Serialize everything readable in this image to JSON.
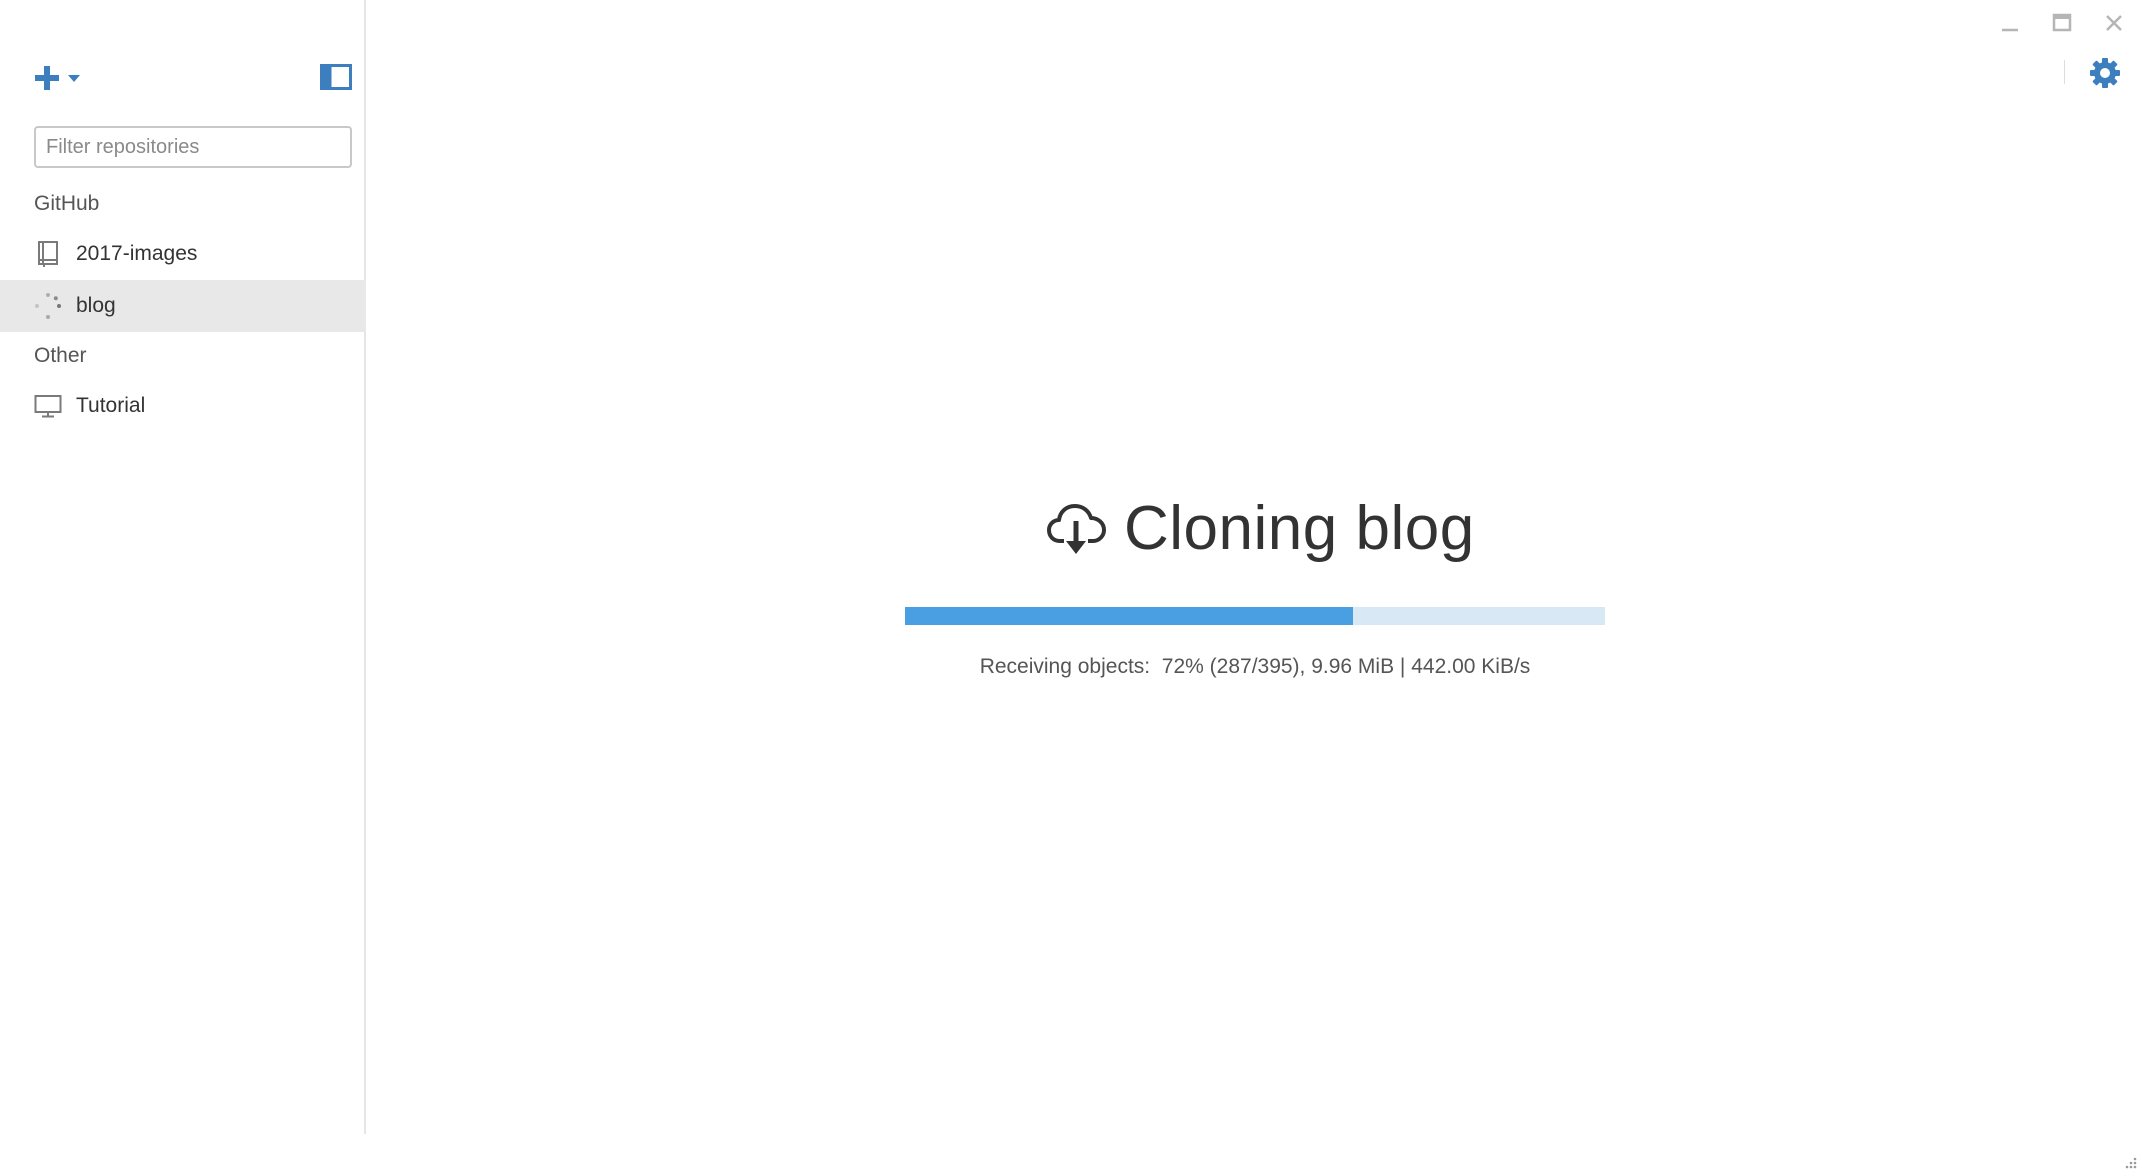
{
  "sidebar": {
    "filter": {
      "placeholder": "Filter repositories",
      "value": ""
    },
    "groups": [
      {
        "label": "GitHub"
      },
      {
        "label": "Other"
      }
    ],
    "repos": [
      {
        "label": "2017-images",
        "icon": "repo-icon"
      },
      {
        "label": "blog",
        "icon": "loading-spinner-icon",
        "selected": true
      },
      {
        "label": "Tutorial",
        "icon": "monitor-icon"
      }
    ]
  },
  "clone": {
    "title": "Cloning blog",
    "progress": 0.64,
    "status": "Receiving objects:  72% (287/395), 9.96 MiB | 442.00 KiB/s"
  },
  "colors": {
    "accent": "#4a9fe3",
    "progress_track": "#d9e8f5",
    "icon_blue": "#3d7ebf",
    "selected_bg": "#e8e8e8"
  }
}
